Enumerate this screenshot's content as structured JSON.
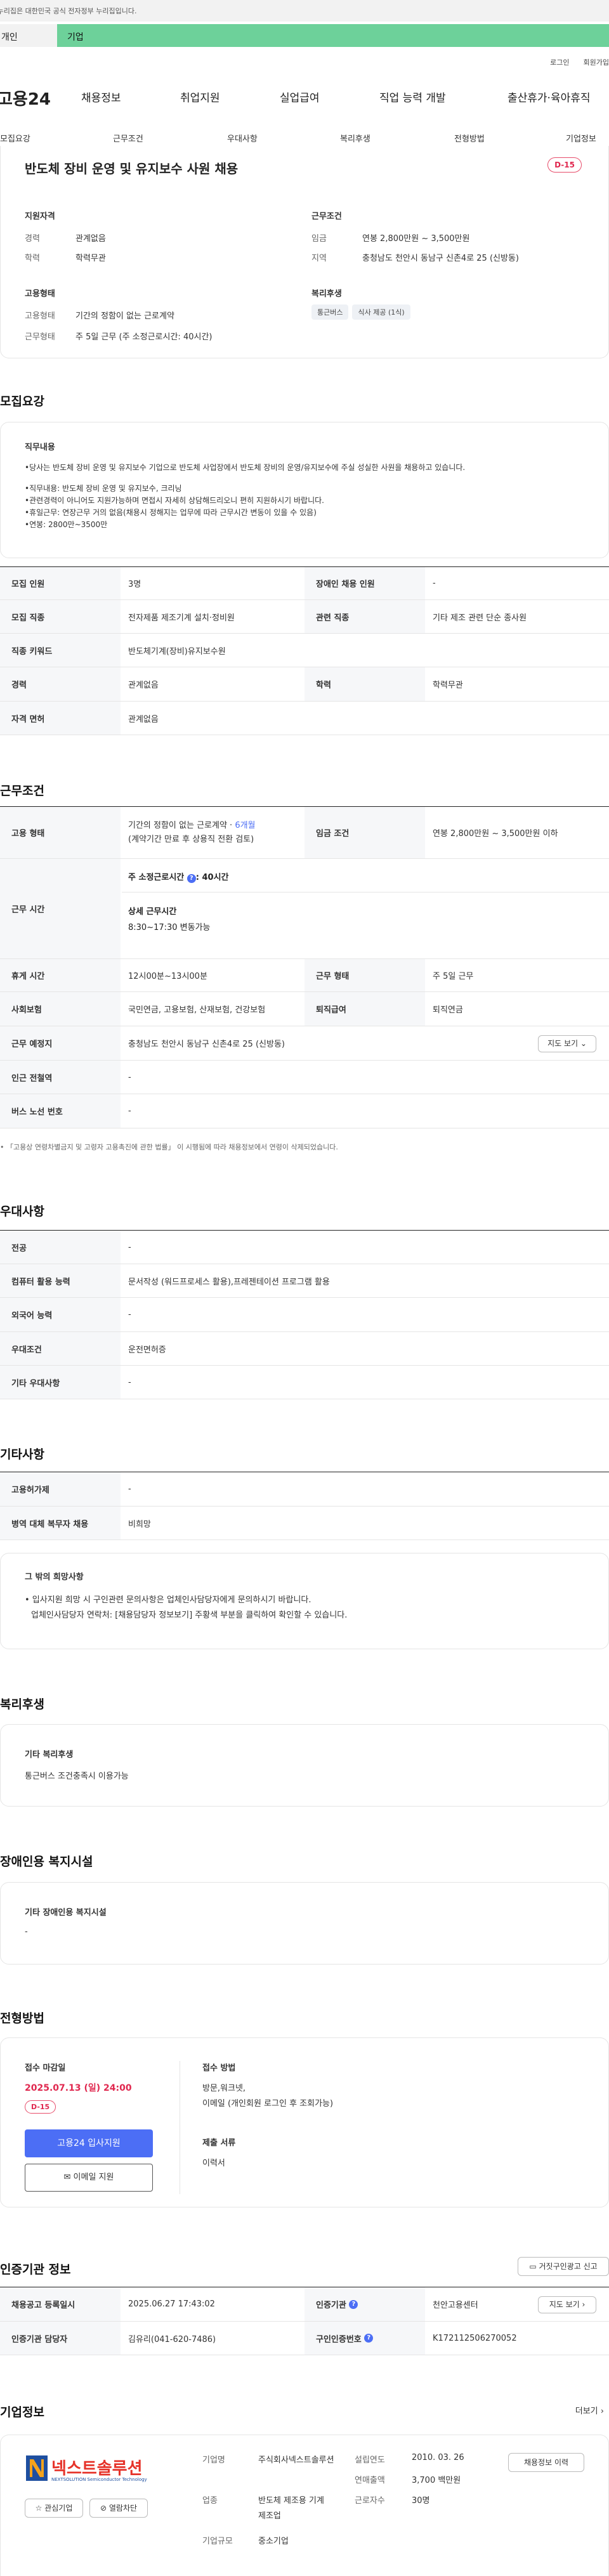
{
  "gov_banner": "이 누리집은 대한민국 공식 전자정부 누리집입니다.",
  "tabs": {
    "first": "개인",
    "second": "기업"
  },
  "toplinks": {
    "login": "로그인",
    "join": "회원가입"
  },
  "gnb": {
    "logo": "고용24",
    "items": [
      "채용정보",
      "취업지원",
      "실업급여",
      "직업 능력 개발",
      "출산휴가·육아휴직"
    ]
  },
  "subnav": [
    "모집요강",
    "근무조건",
    "우대사항",
    "복리후생",
    "전형방법",
    "기업정보"
  ],
  "job": {
    "title": "반도체 장비 운영 및 유지보수 사원 채용",
    "dday": "D-15",
    "qual_title": "지원자격",
    "career_l": "경력",
    "career_v": "관계없음",
    "edu_l": "학력",
    "edu_v": "학력무관",
    "cond_title": "근무조건",
    "wage_l": "임금",
    "wage_v": "연봉 2,800만원 ~ 3,500만원",
    "region_l": "지역",
    "region_v": "충청남도 천안시 동남구 신촌4로 25 (신방동)",
    "emp_title": "고용형태",
    "emptype_l": "고용형태",
    "emptype_v": "기간의 정함이 없는 근로계약",
    "workform_l": "근무형태",
    "workform_v": "주 5일 근무 (주 소정근로시간: 40시간)",
    "welfare_title": "복리후생",
    "welfare_chips": [
      "통근버스",
      "식사 제공 (1식)"
    ]
  },
  "recruit": {
    "heading": "모집요강",
    "duty_title": "직무내용",
    "duty_lines": [
      "•당사는 반도체 장비 운영 및 유지보수 기업으로 반도체 사업장에서 반도체 장비의 운영/유지보수에 주실 성실한 사원을 채용하고 있습니다.",
      "",
      "•직무내용: 반도체 장비 운영 및 유지보수, 크리닝",
      "•관련경력이 아니어도 지원가능하며 면접시 자세히 상담해드리오니 편히 지원하시기 바랍니다.",
      "•휴일근무: 연장근무 거의 없음(채용시 정해지는 업무에 따라 근무시간 변동이 있을 수 있음)",
      "•연봉: 2800만~3500만"
    ],
    "rows": [
      {
        "l1": "모집 인원",
        "v1": "3명",
        "l2": "장애인 채용 인원",
        "v2": "-"
      },
      {
        "l1": "모집 직종",
        "v1": "전자제품 제조기계 설치·정비원",
        "l2": "관련 직종",
        "v2": "기타 제조 관련 단순 종사원"
      },
      {
        "l1": "직종 키워드",
        "v1": "반도체기계(장비)유지보수원"
      },
      {
        "l1": "경력",
        "v1": "관계없음",
        "l2": "학력",
        "v2": "학력무관"
      },
      {
        "l1": "자격 면허",
        "v1": "관계없음"
      }
    ]
  },
  "work": {
    "heading": "근무조건",
    "emp_l": "고용 형태",
    "emp_v1": "기간의 정함이 없는 근로계약 · ",
    "emp_v1b": "6개월",
    "emp_v2": "(계약기간 만료 후 상용직 전환 검토)",
    "wage_l": "임금 조건",
    "wage_v": "연봉 2,800만원 ~ 3,500만원 이하",
    "time_l": "근무 시간",
    "time_week": "주 소정근로시간",
    "time_week_v": ": 40시간",
    "time_detail_t": "상세 근무시간",
    "time_detail_v": "8:30~17:30 변동가능",
    "rest_l": "휴게 시간",
    "rest_v": "12시00분~13시00분",
    "form_l": "근무 형태",
    "form_v": "주 5일 근무",
    "ins_l": "사회보험",
    "ins_v": "국민연금, 고용보험, 산재보험, 건강보험",
    "ret_l": "퇴직급여",
    "ret_v": "퇴직연금",
    "place_l": "근무 예정지",
    "place_v": "충청남도 천안시 동남구 신촌4로 25 (신방동)",
    "map_btn": "지도 보기",
    "subway_l": "인근 전철역",
    "subway_v": "-",
    "bus_l": "버스 노선 번호",
    "bus_v": "-",
    "note": "• 「고용상 연령차별금지 및 고령자 고용촉진에 관한 법률」 이 시행됨에 따라 채용정보에서 연령이 삭제되었습니다."
  },
  "pref": {
    "heading": "우대사항",
    "rows": [
      {
        "l": "전공",
        "v": "-"
      },
      {
        "l": "컴퓨터 활용 능력",
        "v": "문서작성 (워드프로세스 활용),프레젠테이션 프로그램 활용"
      },
      {
        "l": "외국어 능력",
        "v": "-"
      },
      {
        "l": "우대조건",
        "v": "운전면허증"
      },
      {
        "l": "기타 우대사항",
        "v": "-"
      }
    ]
  },
  "etc": {
    "heading": "기타사항",
    "rows": [
      {
        "l": "고용허가제",
        "v": "-"
      },
      {
        "l": "병역 대체 복무자 채용",
        "v": "비희망"
      }
    ],
    "box_title": "그 밖의 희망사항",
    "box_lines": [
      "• 입사지원 희망 시 구인관련 문의사항은 업체인사담당자에게 문의하시기 바랍니다.",
      "업체인사담당자 연락처: [채용담당자 정보보기] 주황색 부분을 클릭하여 확인할 수 있습니다."
    ]
  },
  "welfare": {
    "heading": "복리후생",
    "box_title": "기타 복리후생",
    "box_v": "통근버스 조건충족시 이용가능"
  },
  "disab": {
    "heading": "장애인용 복지시설",
    "box_title": "기타 장애인용 복지시설",
    "box_v": "-"
  },
  "process": {
    "heading": "전형방법",
    "deadline_t": "접수 마감일",
    "deadline_v": "2025.07.13 (일) 24:00",
    "dday": "D-15",
    "apply_btn": "고용24 입사지원",
    "email_btn": "이메일 지원",
    "method_t": "접수 방법",
    "method_v1": "방문,워크넷,",
    "method_v2": "이메일 (개인회원 로그인 후 조회가능)",
    "docs_t": "제출 서류",
    "docs_v": "이력서"
  },
  "cert": {
    "heading": "인증기관 정보",
    "report_btn": "거짓구인광고 신고",
    "reg_l": "채용공고 등록일시",
    "reg_v": "2025.06.27 17:43:02",
    "org_l": "인증기관",
    "org_v": "천안고용센터",
    "map_btn": "지도 보기",
    "mgr_l": "인증기관 담당자",
    "mgr_v": "김유리(041-620-7486)",
    "no_l": "구인인증번호",
    "no_v": "K172112506270052"
  },
  "company": {
    "heading": "기업정보",
    "more": "더보기",
    "logo_text": "넥스트솔루션",
    "logo_sub": "NEXTSOLUTION Semiconductor Technology",
    "fav_btn": "관심기업",
    "block_btn": "열람차단",
    "name_l": "기업명",
    "name_v": "주식회사넥스트솔루션",
    "year_l": "설립연도",
    "year_v": "2010. 03. 26",
    "sales_l": "연매출액",
    "sales_v": "3,700 백만원",
    "ind_l": "업종",
    "ind_v": "반도체 제조용 기계 제조업",
    "staff_l": "근로자수",
    "staff_v": "30명",
    "size_l": "기업규모",
    "size_v": "중소기업",
    "jobs_btn": "채용정보 이력"
  },
  "colors": {
    "accent": "#e0284f",
    "primary": "#4c6ef5",
    "green": "#6dd19a"
  }
}
